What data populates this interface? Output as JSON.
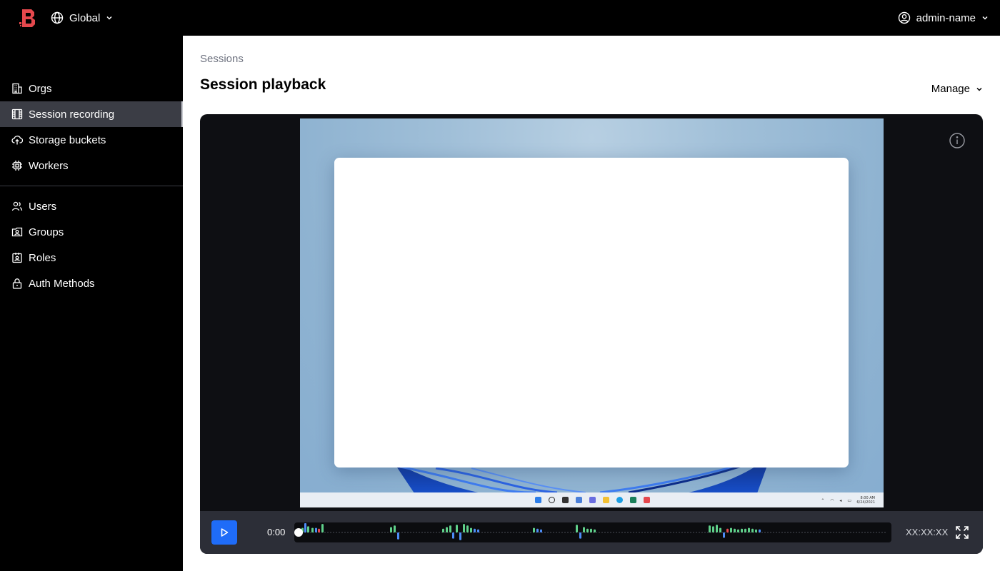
{
  "topbar": {
    "scope_label": "Global",
    "user_label": "admin-name"
  },
  "sidebar": {
    "items": [
      {
        "label": "Orgs",
        "icon": "building-icon",
        "active": false
      },
      {
        "label": "Session recording",
        "icon": "film-icon",
        "active": true
      },
      {
        "label": "Storage buckets",
        "icon": "cloud-upload-icon",
        "active": false
      },
      {
        "label": "Workers",
        "icon": "cpu-icon",
        "active": false
      },
      {
        "label": "Users",
        "icon": "users-icon",
        "active": false
      },
      {
        "label": "Groups",
        "icon": "groups-icon",
        "active": false
      },
      {
        "label": "Roles",
        "icon": "id-card-icon",
        "active": false
      },
      {
        "label": "Auth Methods",
        "icon": "lock-icon",
        "active": false
      }
    ]
  },
  "main": {
    "breadcrumb": "Sessions",
    "title": "Session playback",
    "manage_label": "Manage"
  },
  "player": {
    "current_time": "0:00",
    "total_time": "XX:XX:XX",
    "progress": 0,
    "tray_time": "8:00 AM",
    "tray_date": "6/24/2021",
    "colors": {
      "accent": "#1f6cf8",
      "event_green": "#5fd08a",
      "event_blue": "#4d8df7",
      "event_red": "#e5484d"
    }
  }
}
